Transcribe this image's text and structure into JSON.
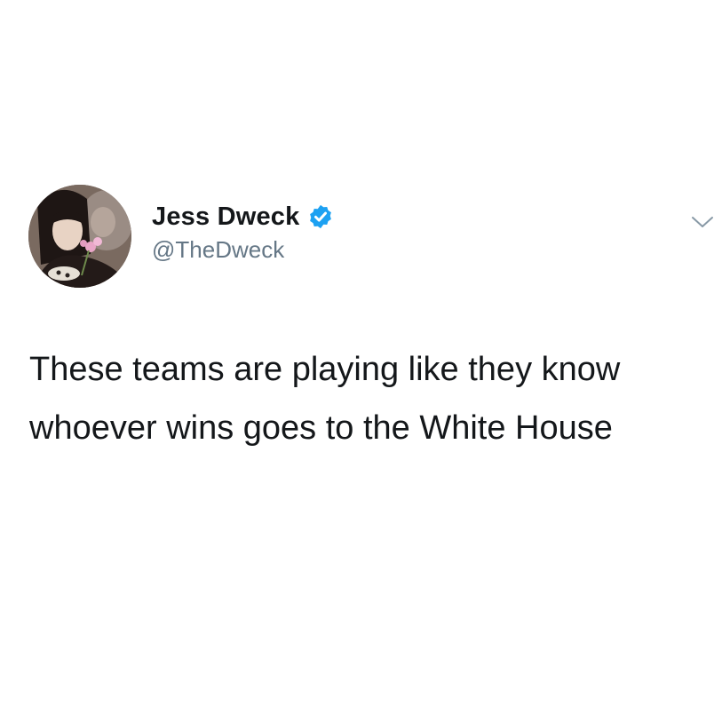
{
  "tweet": {
    "author": {
      "display_name": "Jess Dweck",
      "handle": "@TheDweck",
      "verified": true,
      "avatar": "profile-photo"
    },
    "text": "These teams are playing like they know whoever wins goes to the White House",
    "menu_icon": "chevron-down-icon"
  },
  "colors": {
    "text": "#14171a",
    "handle": "#657786",
    "verified_badge": "#1da1f2",
    "chevron": "#8899a6",
    "background": "#ffffff"
  }
}
